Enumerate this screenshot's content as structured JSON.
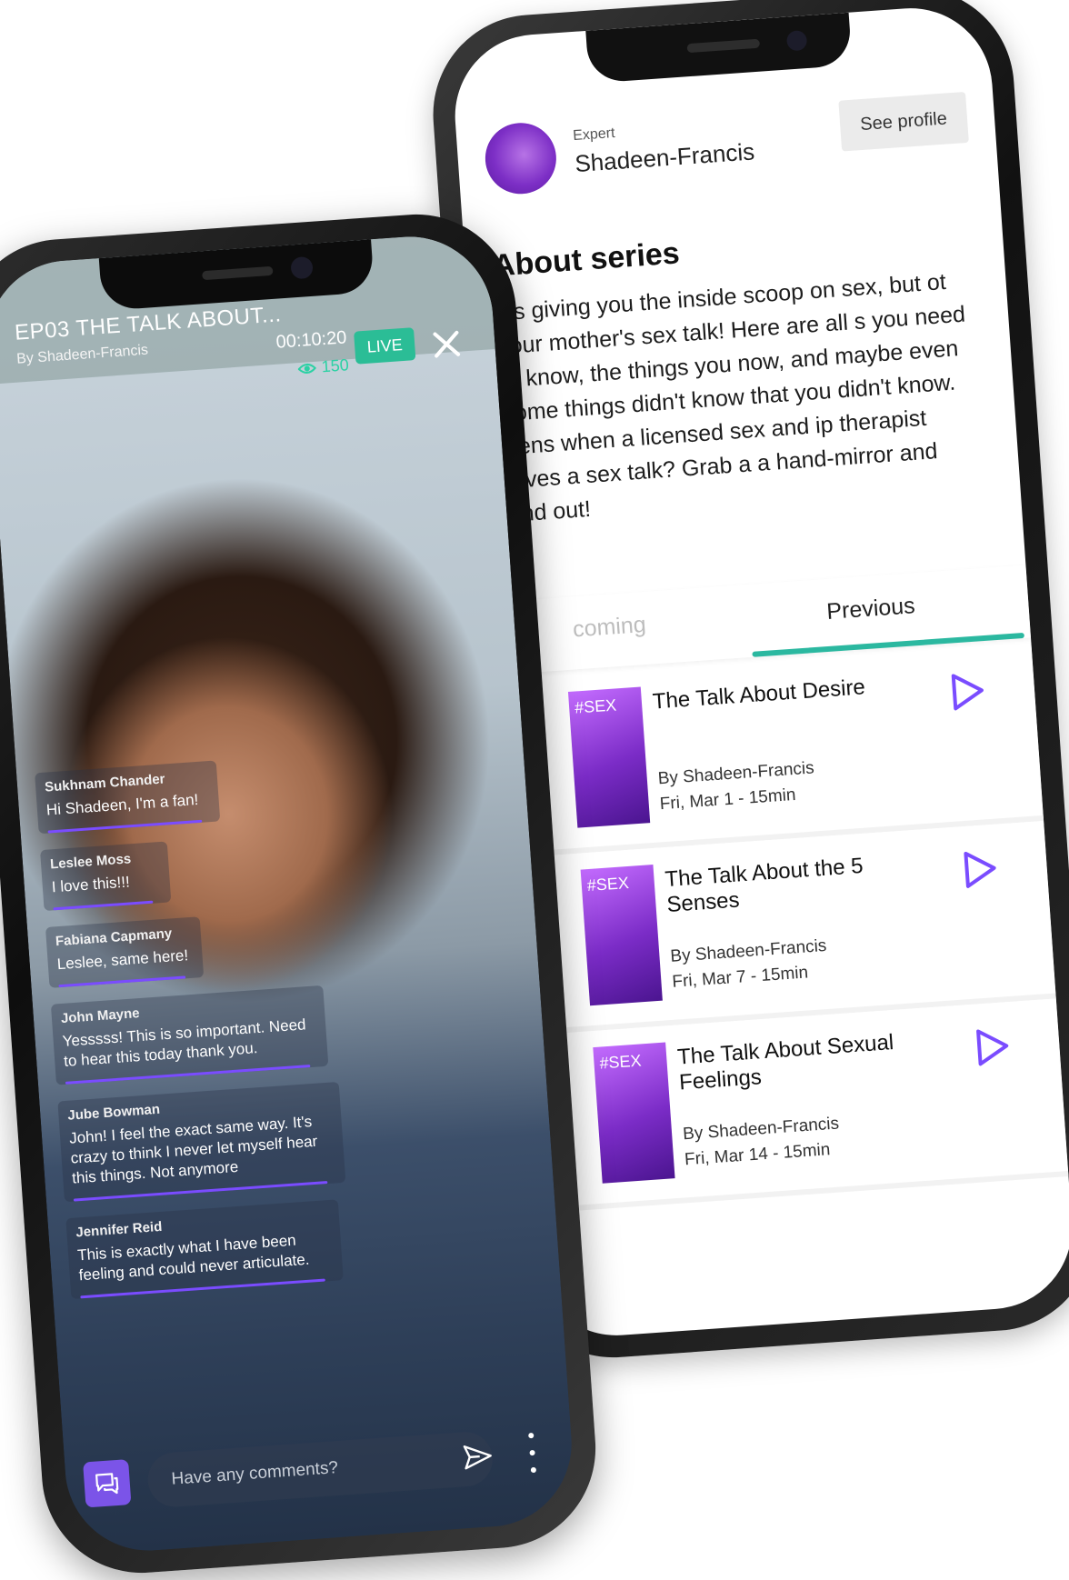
{
  "series_detail": {
    "expert_label": "Expert",
    "expert_name": "Shadeen-Francis",
    "see_profile": "See profile",
    "about_title": "About series",
    "about_text": "ies giving you the inside scoop on sex, but ot your mother's sex talk! Here are all s you need to know, the things you now, and maybe even some things didn't know that you didn't know. pens when a licensed sex and ip therapist gives a sex talk? Grab a a hand-mirror and find out!",
    "tabs": [
      {
        "label": "coming",
        "active": false
      },
      {
        "label": "Previous",
        "active": true
      }
    ],
    "episodes": [
      {
        "tag": "#SEX",
        "title": "The Talk About Desire",
        "by": "By Shadeen-Francis",
        "date": "Fri, Mar 1 - 15min"
      },
      {
        "tag": "#SEX",
        "title": "The Talk About the 5 Senses",
        "by": "By Shadeen-Francis",
        "date": "Fri, Mar 7 - 15min"
      },
      {
        "tag": "#SEX",
        "title": "The Talk About Sexual Feelings",
        "by": "By Shadeen-Francis",
        "date": "Fri, Mar 14 - 15min"
      }
    ],
    "accent_color": "#2bb8a0",
    "play_color": "#7a4cff"
  },
  "live": {
    "episode_title": "EP03 THE TALK ABOUT...",
    "by": "By Shadeen-Francis",
    "timer": "00:10:20",
    "viewers": "150",
    "live_label": "LIVE",
    "comments": [
      {
        "name": "Sukhnam Chander",
        "text": "Hi Shadeen, I'm a fan!"
      },
      {
        "name": "Leslee Moss",
        "text": "I love this!!!"
      },
      {
        "name": "Fabiana Capmany",
        "text": "Leslee, same here!"
      },
      {
        "name": "John Mayne",
        "text": "Yesssss! This is so important. Need to hear this today thank you."
      },
      {
        "name": "Jube Bowman",
        "text": "John! I feel the exact same way. It's crazy to think I never let myself hear this things. Not anymore"
      },
      {
        "name": "Jennifer Reid",
        "text": "This is exactly what I have been feeling and could never articulate."
      }
    ],
    "input_placeholder": "Have any comments?",
    "live_color": "#2bbd96",
    "comment_accent": "#7a4cff"
  }
}
